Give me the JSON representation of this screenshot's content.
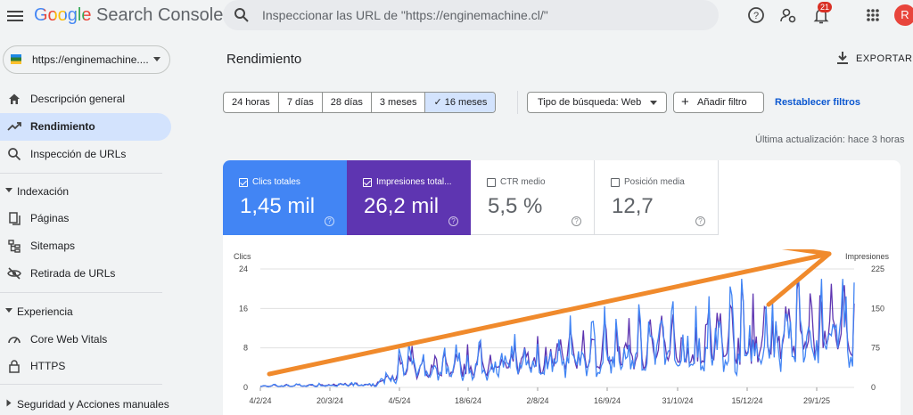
{
  "app": {
    "logo_google": "Google",
    "logo_product": " Search Console",
    "search_placeholder": "Inspeccionar las URL de \"https://enginemachine.cl/\"",
    "notifications_count": "21",
    "avatar_initial": "R"
  },
  "sidebar": {
    "property": "https://enginemachine....",
    "items": [
      {
        "label": "Descripción general",
        "icon": "home-icon"
      },
      {
        "label": "Rendimiento",
        "icon": "trending-up-icon",
        "active": true
      },
      {
        "label": "Inspección de URLs",
        "icon": "search-icon"
      }
    ],
    "sections": [
      {
        "label": "Indexación",
        "items": [
          {
            "label": "Páginas",
            "icon": "pages-icon"
          },
          {
            "label": "Sitemaps",
            "icon": "sitemap-icon"
          },
          {
            "label": "Retirada de URLs",
            "icon": "eye-off-icon"
          }
        ]
      },
      {
        "label": "Experiencia",
        "items": [
          {
            "label": "Core Web Vitals",
            "icon": "gauge-icon"
          },
          {
            "label": "HTTPS",
            "icon": "lock-icon"
          }
        ]
      },
      {
        "label": "Seguridad y Acciones manuales",
        "items": []
      }
    ]
  },
  "main": {
    "title": "Rendimiento",
    "export_label": "EXPORTAR",
    "date_ranges": [
      "24 horas",
      "7 días",
      "28 días",
      "3 meses",
      "16 meses"
    ],
    "selected_range": "16 meses",
    "search_type": "Tipo de búsqueda: Web",
    "add_filter": "Añadir filtro",
    "reset_filters": "Restablecer filtros",
    "last_updated": "Última actualización: hace 3 horas"
  },
  "metrics": [
    {
      "label": "Clics totales",
      "value": "1,45 mil",
      "checked": true,
      "color": "#4285f4"
    },
    {
      "label": "Impresiones total...",
      "value": "26,2 mil",
      "checked": true,
      "color": "#5e35b1"
    },
    {
      "label": "CTR medio",
      "value": "5,5 %",
      "checked": false
    },
    {
      "label": "Posición media",
      "value": "12,7",
      "checked": false
    }
  ],
  "chart_data": {
    "type": "line",
    "ylabel_left": "Clics",
    "ylabel_right": "Impresiones",
    "y_left_ticks": [
      "24",
      "16",
      "8",
      "0"
    ],
    "y_right_ticks": [
      "225",
      "150",
      "75",
      "0"
    ],
    "ylim_left": [
      0,
      24
    ],
    "ylim_right": [
      0,
      225
    ],
    "x_ticks": [
      "4/2/24",
      "20/3/24",
      "4/5/24",
      "18/6/24",
      "2/8/24",
      "16/9/24",
      "31/10/24",
      "15/12/24",
      "29/1/25"
    ],
    "grid": true,
    "series": [
      {
        "name": "Clics",
        "color": "#4285f4",
        "axis": "left"
      },
      {
        "name": "Impresiones",
        "color": "#5e35b1",
        "axis": "right"
      }
    ],
    "annotation": {
      "type": "arrow",
      "color": "#f08a2c"
    }
  }
}
